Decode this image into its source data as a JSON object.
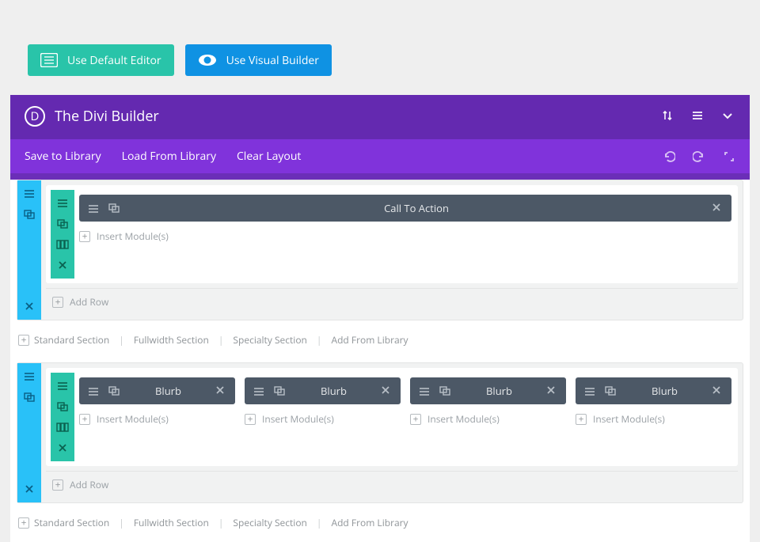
{
  "topButtons": {
    "defaultEditor": "Use Default Editor",
    "visualBuilder": "Use Visual Builder"
  },
  "panel": {
    "logoLetter": "D",
    "title": "The Divi Builder",
    "subLinks": {
      "save": "Save to Library",
      "load": "Load From Library",
      "clear": "Clear Layout"
    }
  },
  "labels": {
    "insertModule": "Insert Module(s)",
    "addRow": "Add Row",
    "standardSection": "Standard Section",
    "fullwidthSection": "Fullwidth Section",
    "specialtySection": "Specialty Section",
    "addFromLibrary": "Add From Library"
  },
  "sections": [
    {
      "rows": [
        {
          "columns": [
            {
              "module": "Call To Action"
            }
          ]
        }
      ]
    },
    {
      "rows": [
        {
          "columns": [
            {
              "module": "Blurb"
            },
            {
              "module": "Blurb"
            },
            {
              "module": "Blurb"
            },
            {
              "module": "Blurb"
            }
          ]
        }
      ]
    }
  ]
}
